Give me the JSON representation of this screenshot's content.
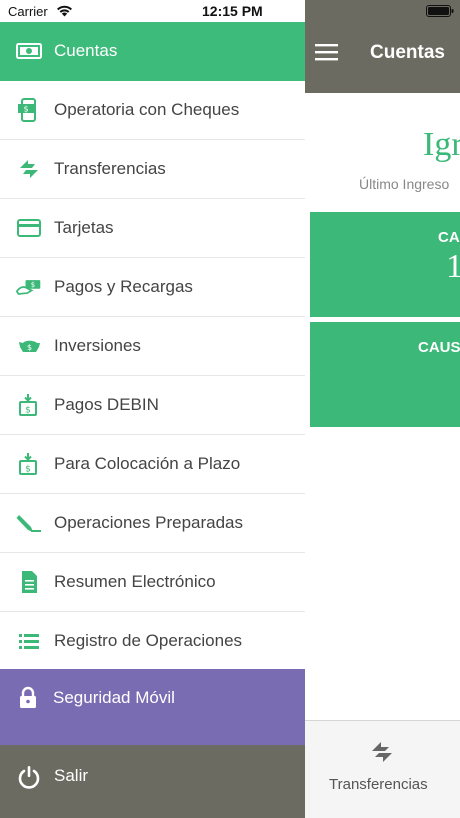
{
  "status_bar": {
    "carrier": "Carrier",
    "time": "12:15 PM"
  },
  "app": {
    "header_title": "Cuentas",
    "greeting": "Igr",
    "last_login": "Último Ingreso",
    "card_1": {
      "label": "CA",
      "value": "1"
    },
    "card_2": {
      "label": "CAUS"
    },
    "tab": {
      "label": "Transferencias",
      "icon": "transfer-arrows-icon"
    }
  },
  "menu": {
    "items": [
      {
        "label": "Cuentas",
        "icon": "banknote-icon",
        "active": true
      },
      {
        "label": "Operatoria con Cheques",
        "icon": "mobile-cheque-icon"
      },
      {
        "label": "Transferencias",
        "icon": "transfer-arrows-icon"
      },
      {
        "label": "Tarjetas",
        "icon": "credit-card-icon"
      },
      {
        "label": "Pagos y Recargas",
        "icon": "payment-hand-icon"
      },
      {
        "label": "Inversiones",
        "icon": "piggy-bank-icon"
      },
      {
        "label": "Pagos DEBIN",
        "icon": "money-download-icon"
      },
      {
        "label": "Para Colocación a Plazo",
        "icon": "money-download-icon"
      },
      {
        "label": "Operaciones Preparadas",
        "icon": "pencil-icon"
      },
      {
        "label": "Resumen Electrónico",
        "icon": "document-icon"
      },
      {
        "label": "Registro de Operaciones",
        "icon": "list-icon"
      }
    ],
    "security": {
      "label": "Seguridad Móvil",
      "icon": "lock-icon"
    },
    "logout": {
      "label": "Salir",
      "icon": "power-icon"
    }
  },
  "colors": {
    "green": "#3dbb7a",
    "header_gray": "#6b6b61",
    "purple": "#7a6cb2"
  }
}
